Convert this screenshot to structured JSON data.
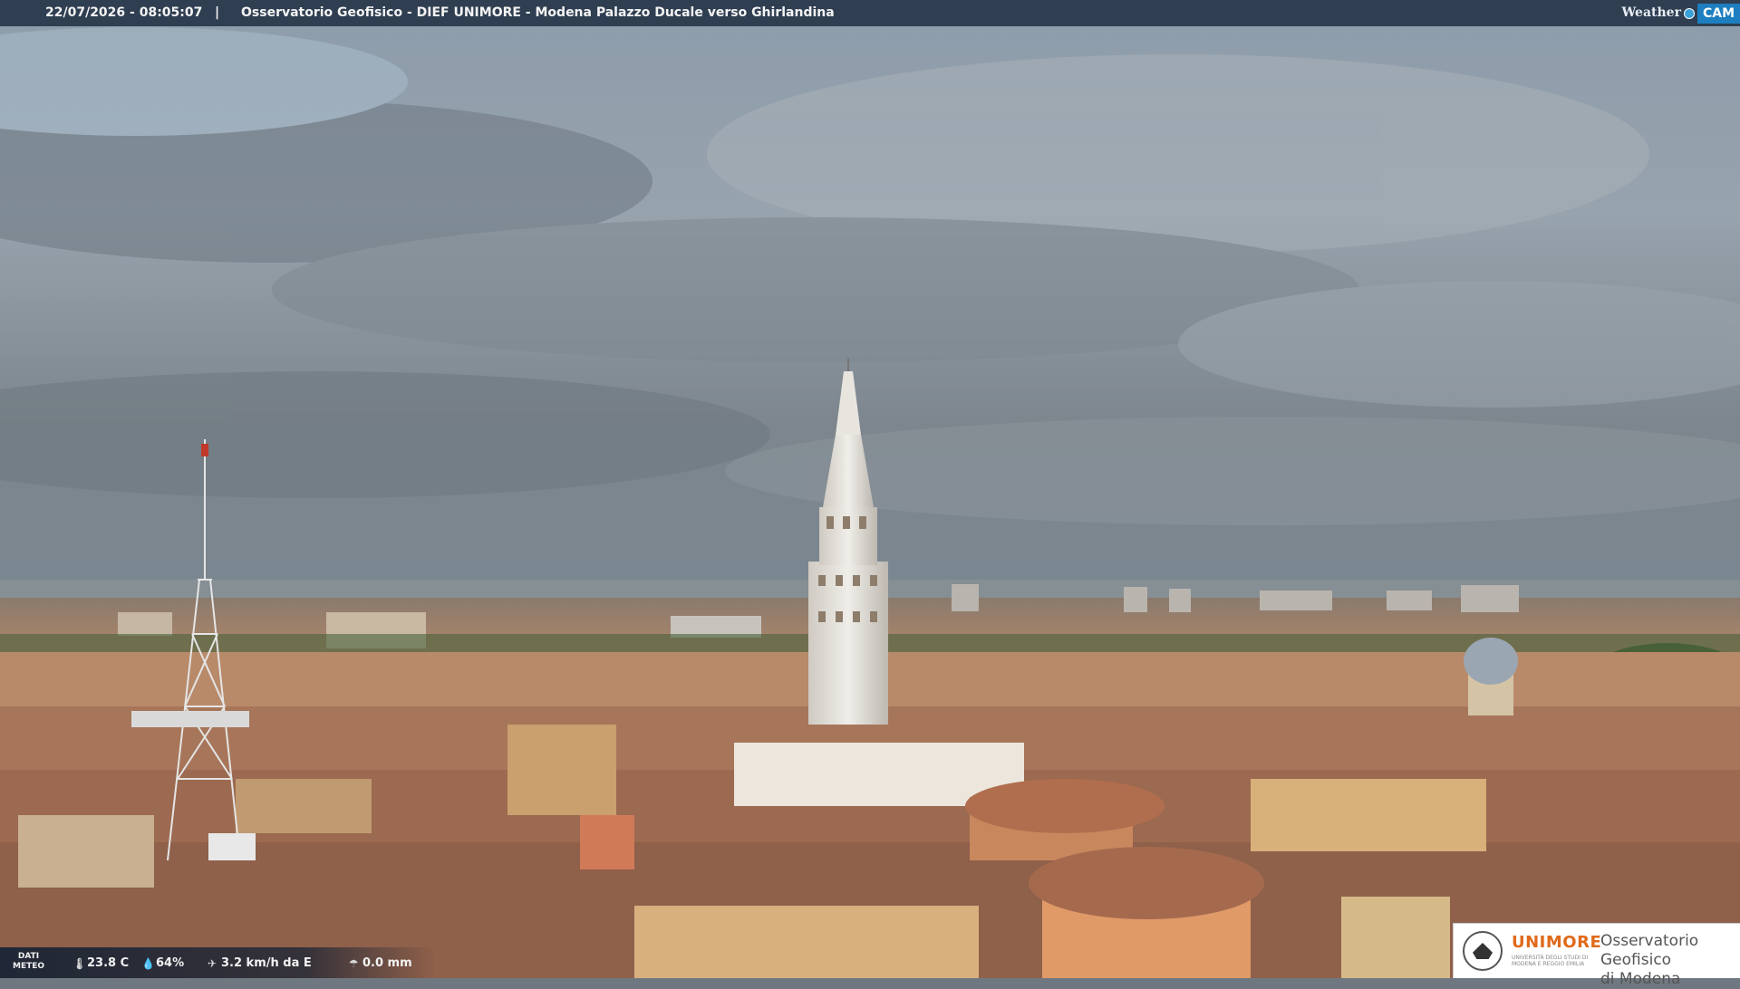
{
  "header": {
    "timestamp": "22/07/2026 - 08:05:07",
    "separator": "|",
    "title": "Osservatorio Geofisico - DIEF UNIMORE - Modena Palazzo Ducale verso Ghirlandina"
  },
  "brand": {
    "part1": "Weather",
    "part2": "CAM"
  },
  "meteo": {
    "label_line1": "DATI",
    "label_line2": "METEO",
    "temperature": "23.8 C",
    "humidity": "64%",
    "wind": "3.2 km/h da E",
    "rain": "0.0 mm"
  },
  "logo": {
    "university": "UNIMORE",
    "university_sub": "UNIVERSITÀ DEGLI STUDI DI MODENA E REGGIO EMILIA",
    "observatory_line1": "Osservatorio Geofisico",
    "observatory_line2": "di Modena"
  },
  "colors": {
    "sky_top": "#8c9aa8",
    "sky_bottom": "#7b858e",
    "roofs": "#a86f54",
    "tower": "#e4e2dd"
  }
}
